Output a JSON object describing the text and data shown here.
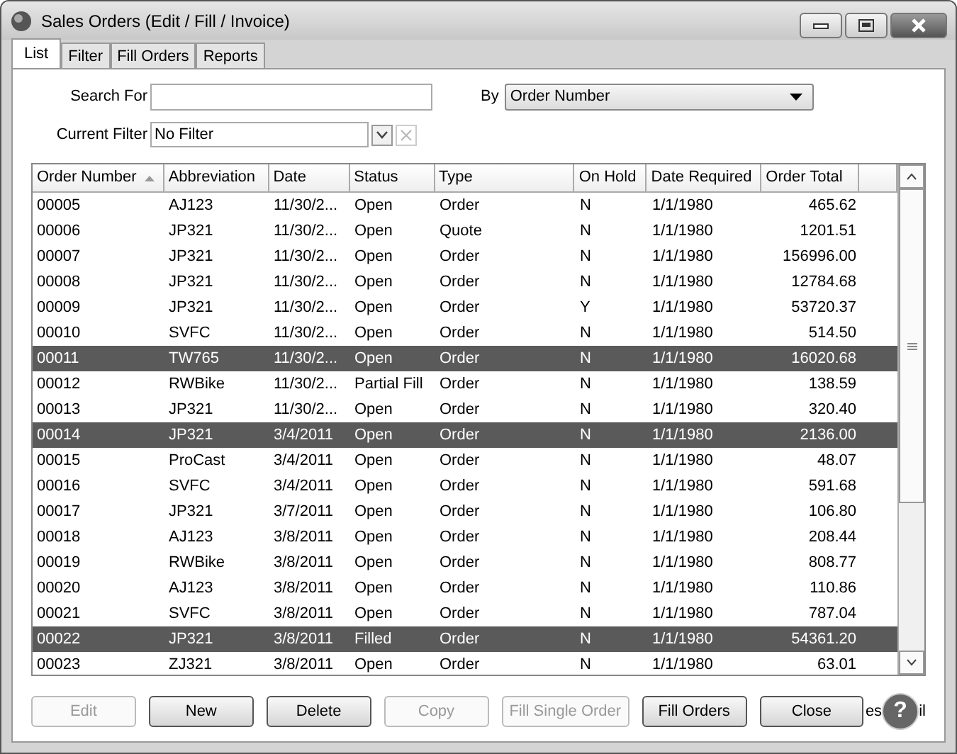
{
  "window": {
    "title": "Sales Orders (Edit / Fill / Invoice)"
  },
  "tabs": [
    {
      "label": "List",
      "selected": true
    },
    {
      "label": "Filter",
      "selected": false
    },
    {
      "label": "Fill Orders",
      "selected": false
    },
    {
      "label": "Reports",
      "selected": false
    }
  ],
  "search": {
    "label": "Search For",
    "by_label": "By",
    "by_value": "Order Number"
  },
  "filter": {
    "label": "Current Filter",
    "value": "No Filter"
  },
  "table": {
    "columns": [
      {
        "label": "Order Number",
        "sorted": true
      },
      {
        "label": "Abbreviation",
        "sorted": false
      },
      {
        "label": "Date",
        "sorted": false
      },
      {
        "label": "Status",
        "sorted": false
      },
      {
        "label": "Type",
        "sorted": false
      },
      {
        "label": "On Hold",
        "sorted": false
      },
      {
        "label": "Date Required",
        "sorted": false
      },
      {
        "label": "Order Total",
        "sorted": false
      }
    ],
    "rows": [
      {
        "cells": [
          "00005",
          "AJ123",
          "11/30/2...",
          "Open",
          "Order",
          "N",
          "1/1/1980",
          "465.62"
        ],
        "selected": false
      },
      {
        "cells": [
          "00006",
          "JP321",
          "11/30/2...",
          "Open",
          "Quote",
          "N",
          "1/1/1980",
          "1201.51"
        ],
        "selected": false
      },
      {
        "cells": [
          "00007",
          "JP321",
          "11/30/2...",
          "Open",
          "Order",
          "N",
          "1/1/1980",
          "156996.00"
        ],
        "selected": false
      },
      {
        "cells": [
          "00008",
          "JP321",
          "11/30/2...",
          "Open",
          "Order",
          "N",
          "1/1/1980",
          "12784.68"
        ],
        "selected": false
      },
      {
        "cells": [
          "00009",
          "JP321",
          "11/30/2...",
          "Open",
          "Order",
          "Y",
          "1/1/1980",
          "53720.37"
        ],
        "selected": false
      },
      {
        "cells": [
          "00010",
          "SVFC",
          "11/30/2...",
          "Open",
          "Order",
          "N",
          "1/1/1980",
          "514.50"
        ],
        "selected": false
      },
      {
        "cells": [
          "00011",
          "TW765",
          "11/30/2...",
          "Open",
          "Order",
          "N",
          "1/1/1980",
          "16020.68"
        ],
        "selected": true
      },
      {
        "cells": [
          "00012",
          "RWBike",
          "11/30/2...",
          "Partial Fill",
          "Order",
          "N",
          "1/1/1980",
          "138.59"
        ],
        "selected": false
      },
      {
        "cells": [
          "00013",
          "JP321",
          "11/30/2...",
          "Open",
          "Order",
          "N",
          "1/1/1980",
          "320.40"
        ],
        "selected": false
      },
      {
        "cells": [
          "00014",
          "JP321",
          "3/4/2011",
          "Open",
          "Order",
          "N",
          "1/1/1980",
          "2136.00"
        ],
        "selected": true
      },
      {
        "cells": [
          "00015",
          "ProCast",
          "3/4/2011",
          "Open",
          "Order",
          "N",
          "1/1/1980",
          "48.07"
        ],
        "selected": false
      },
      {
        "cells": [
          "00016",
          "SVFC",
          "3/4/2011",
          "Open",
          "Order",
          "N",
          "1/1/1980",
          "591.68"
        ],
        "selected": false
      },
      {
        "cells": [
          "00017",
          "JP321",
          "3/7/2011",
          "Open",
          "Order",
          "N",
          "1/1/1980",
          "106.80"
        ],
        "selected": false
      },
      {
        "cells": [
          "00018",
          "AJ123",
          "3/8/2011",
          "Open",
          "Order",
          "N",
          "1/1/1980",
          "208.44"
        ],
        "selected": false
      },
      {
        "cells": [
          "00019",
          "RWBike",
          "3/8/2011",
          "Open",
          "Order",
          "N",
          "1/1/1980",
          "808.77"
        ],
        "selected": false
      },
      {
        "cells": [
          "00020",
          "AJ123",
          "3/8/2011",
          "Open",
          "Order",
          "N",
          "1/1/1980",
          "110.86"
        ],
        "selected": false
      },
      {
        "cells": [
          "00021",
          "SVFC",
          "3/8/2011",
          "Open",
          "Order",
          "N",
          "1/1/1980",
          "787.04"
        ],
        "selected": false
      },
      {
        "cells": [
          "00022",
          "JP321",
          "3/8/2011",
          "Filled",
          "Order",
          "N",
          "1/1/1980",
          "54361.20"
        ],
        "selected": true
      },
      {
        "cells": [
          "00023",
          "ZJ321",
          "3/8/2011",
          "Open",
          "Order",
          "N",
          "1/1/1980",
          "63.01"
        ],
        "selected": false
      }
    ]
  },
  "buttons": [
    {
      "label": "Edit",
      "disabled": true
    },
    {
      "label": "New",
      "disabled": false
    },
    {
      "label": "Delete",
      "disabled": false
    },
    {
      "label": "Copy",
      "disabled": true
    },
    {
      "label": "Fill Single Order",
      "disabled": true
    },
    {
      "label": "Fill Orders",
      "disabled": false
    },
    {
      "label": "Close",
      "disabled": false
    }
  ],
  "hidden_button_fragments": [
    "es",
    "il"
  ],
  "help_button": {
    "label": "?"
  }
}
